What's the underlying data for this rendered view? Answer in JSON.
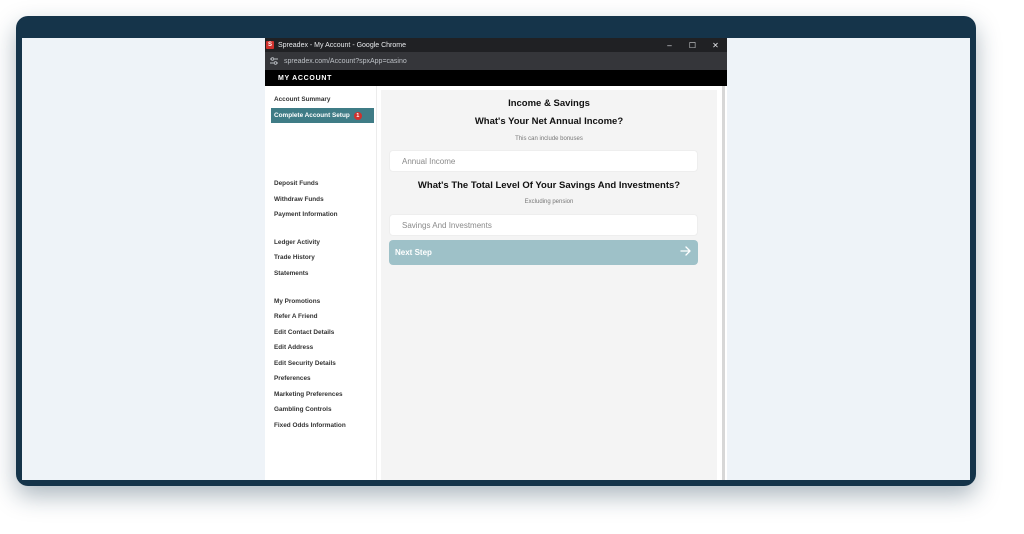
{
  "browser": {
    "window_title": "Spreadex - My Account - Google Chrome",
    "favicon_letter": "S",
    "url": "spreadex.com/Account?spxApp=casino",
    "controls": [
      "–",
      "☐",
      "✕"
    ]
  },
  "header": {
    "title": "MY ACCOUNT"
  },
  "sidebar": {
    "items": [
      {
        "label": "Account Summary"
      },
      {
        "label": "Complete Account Setup",
        "badge": "1"
      },
      {
        "label": "Deposit Funds"
      },
      {
        "label": "Withdraw Funds"
      },
      {
        "label": "Payment Information"
      },
      {
        "label": "Ledger Activity"
      },
      {
        "label": "Trade History"
      },
      {
        "label": "Statements"
      },
      {
        "label": "My Promotions"
      },
      {
        "label": "Refer A Friend"
      },
      {
        "label": "Edit Contact Details"
      },
      {
        "label": "Edit Address"
      },
      {
        "label": "Edit Security Details"
      },
      {
        "label": "Preferences"
      },
      {
        "label": "Marketing Preferences"
      },
      {
        "label": "Gambling Controls"
      },
      {
        "label": "Fixed Odds Information"
      }
    ]
  },
  "form": {
    "section_title": "Income & Savings",
    "income_question": "What's Your Net Annual Income?",
    "income_hint": "This can include bonuses",
    "income_placeholder": "Annual Income",
    "savings_question": "What's The Total Level Of Your Savings And Investments?",
    "savings_hint": "Excluding pension",
    "savings_placeholder": "Savings And Investments",
    "next_label": "Next Step"
  },
  "icons": {
    "favicon": "spreadex-logo-icon",
    "site_info": "tune-icon",
    "next": "arrow-right-icon"
  },
  "colors": {
    "frame": "#15344a",
    "active_nav": "#3f7c86",
    "badge": "#d0312d",
    "next_button": "#9ec1c8"
  }
}
